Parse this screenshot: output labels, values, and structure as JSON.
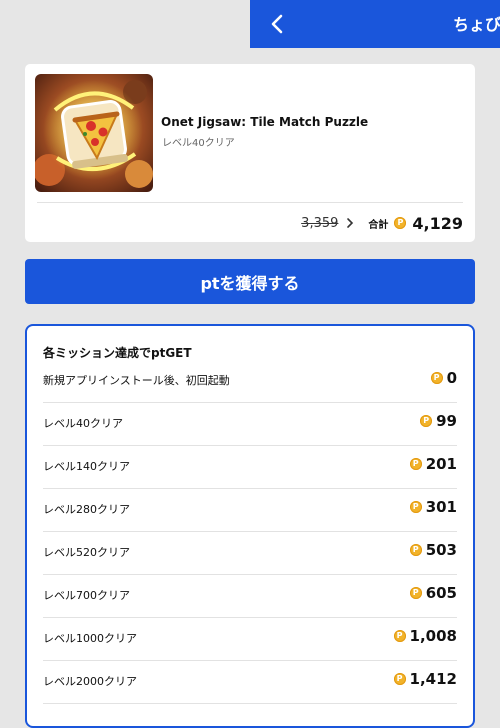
{
  "header": {
    "title": "ちょび",
    "back_icon": "chevron-left-icon"
  },
  "app": {
    "name": "Onet Jigsaw: Tile Match Puzzle",
    "subtitle": "レベル40クリア",
    "thumbnail_icon": "pizza-tile-icon",
    "old_price": "3,359",
    "total_label": "合計",
    "total_value": "4,129",
    "coin_symbol": "P"
  },
  "cta": {
    "label": "ptを獲得する"
  },
  "missions": {
    "title": "各ミッション達成でptGET",
    "coin_symbol": "P",
    "items": [
      {
        "label": "新規アプリインストール後、初回起動",
        "points": "0"
      },
      {
        "label": "レベル40クリア",
        "points": "99"
      },
      {
        "label": "レベル140クリア",
        "points": "201"
      },
      {
        "label": "レベル280クリア",
        "points": "301"
      },
      {
        "label": "レベル520クリア",
        "points": "503"
      },
      {
        "label": "レベル700クリア",
        "points": "605"
      },
      {
        "label": "レベル1000クリア",
        "points": "1,008"
      },
      {
        "label": "レベル2000クリア",
        "points": "1,412"
      }
    ]
  },
  "colors": {
    "brand_blue": "#1a56db",
    "coin_gold": "#f2b32a",
    "background": "#e6e6e6"
  }
}
